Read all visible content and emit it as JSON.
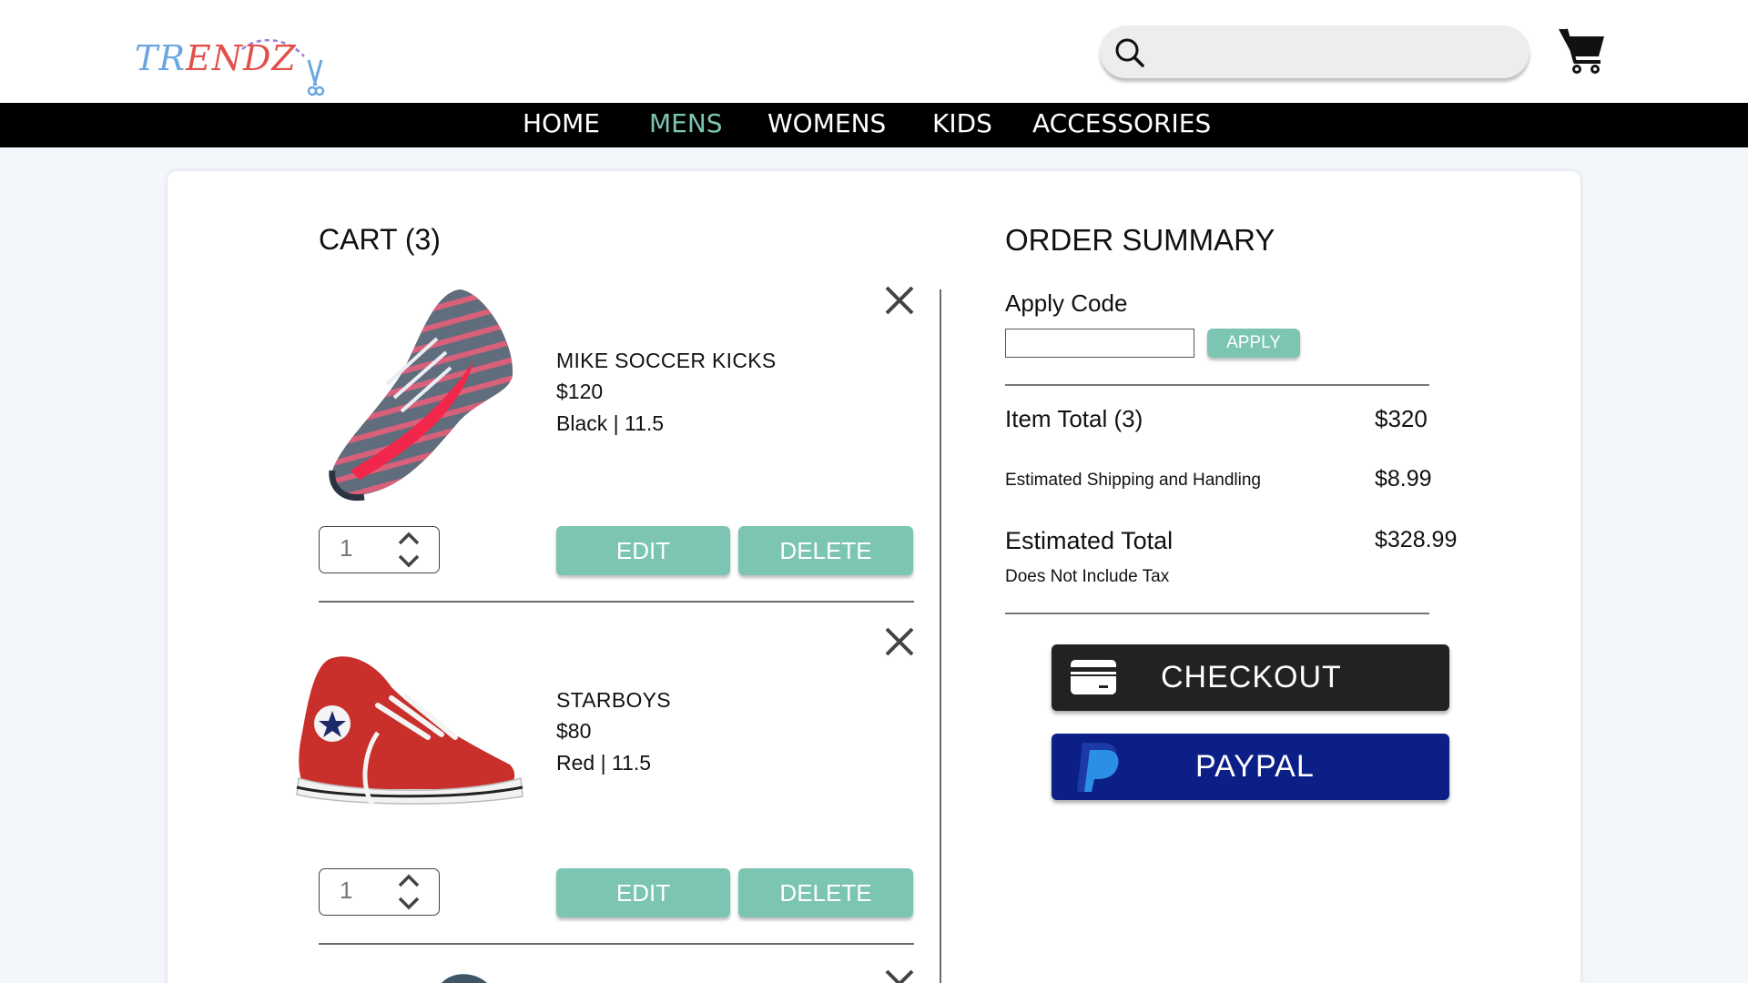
{
  "brand": {
    "logo_text_part1": "TR",
    "logo_text_part2": "ENDZ"
  },
  "header": {
    "search": {
      "placeholder": "",
      "value": ""
    },
    "icons": [
      "search-icon",
      "shopping-cart-icon"
    ]
  },
  "nav": {
    "items": [
      {
        "label": "HOME"
      },
      {
        "label": "MENS",
        "active": true
      },
      {
        "label": "WOMENS"
      },
      {
        "label": "KIDS"
      },
      {
        "label": "ACCESSORIES"
      }
    ]
  },
  "cart": {
    "title": "CART (3)",
    "items": [
      {
        "name": "MIKE SOCCER KICKS",
        "price": "$120",
        "variant": "Black | 11.5",
        "quantity": "1",
        "edit_label": "EDIT",
        "delete_label": "DELETE"
      },
      {
        "name": "STARBOYS",
        "price": "$80",
        "variant": "Red | 11.5",
        "quantity": "1",
        "edit_label": "EDIT",
        "delete_label": "DELETE"
      }
    ]
  },
  "summary": {
    "title": "ORDER SUMMARY",
    "apply_code_label": "Apply Code",
    "apply_code_value": "",
    "apply_button": "APPLY",
    "item_total_label": "Item Total (3)",
    "item_total_value": "$320",
    "shipping_label": "Estimated Shipping and Handling",
    "shipping_value": "$8.99",
    "estimated_total_label": "Estimated Total",
    "estimated_total_value": "$328.99",
    "tax_note": "Does Not Include Tax",
    "checkout_label": "CHECKOUT",
    "paypal_label": "PAYPAL"
  },
  "colors": {
    "accent_green": "#7cc5b3",
    "nav_background": "#000000",
    "checkout_background": "#222222",
    "paypal_background": "#0c1f86",
    "logo_blue": "#6aa7e0",
    "logo_red": "#e2504a"
  }
}
